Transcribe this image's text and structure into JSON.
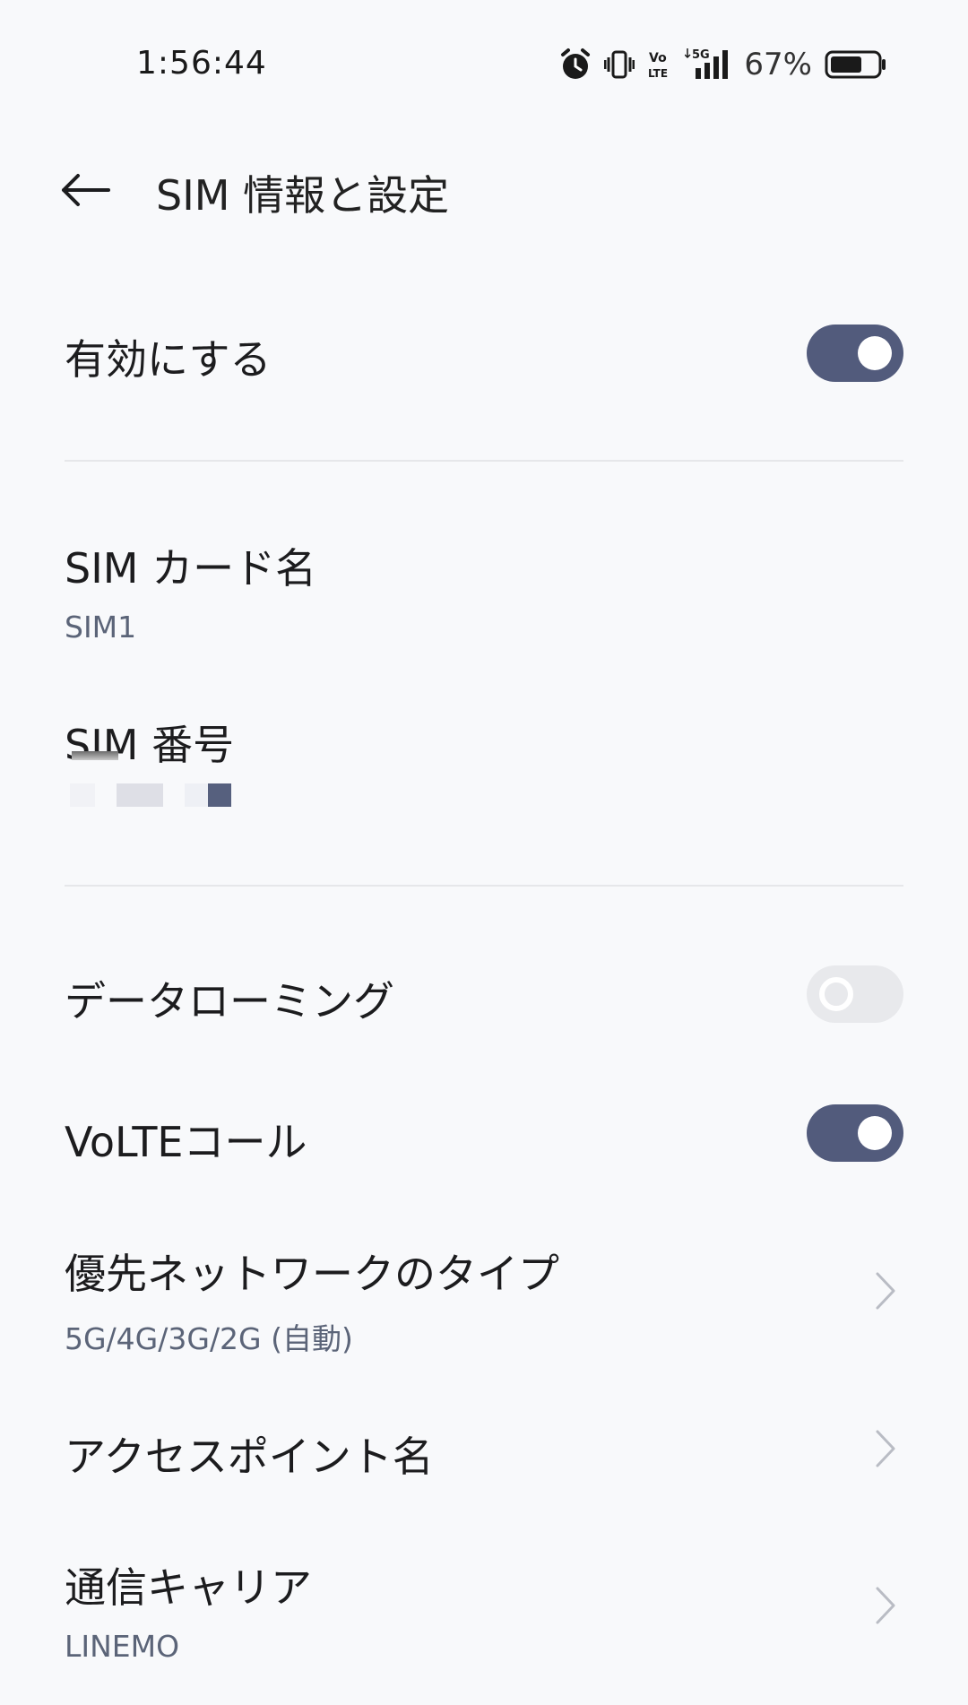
{
  "status_bar": {
    "time": "1:56:44",
    "battery_percent": "67%",
    "battery_level": 0.67,
    "network_label": "5G",
    "volte_label": "Vo LTE",
    "icons": [
      "alarm-icon",
      "vibrate-icon",
      "volte-icon",
      "signal-5g-icon",
      "battery-icon"
    ]
  },
  "header": {
    "title": "SIM 情報と設定",
    "back_icon": "arrow-left-icon"
  },
  "settings": {
    "enable": {
      "label": "有効にする",
      "enabled": true
    },
    "sim_card_name": {
      "label": "SIM カード名",
      "value": "SIM1"
    },
    "sim_number": {
      "label": "SIM 番号"
    },
    "data_roaming": {
      "label": "データローミング",
      "enabled": false
    },
    "volte_call": {
      "label": "VoLTEコール",
      "enabled": true
    },
    "preferred_network": {
      "label": "優先ネットワークのタイプ",
      "value": "5G/4G/3G/2G (自動)"
    },
    "apn": {
      "label": "アクセスポイント名"
    },
    "carrier": {
      "label": "通信キャリア",
      "value": "LINEMO"
    }
  },
  "colors": {
    "background": "#f8f9fb",
    "accent": "#525b7c",
    "subtext": "#5b6478",
    "divider": "#e6e7ea"
  }
}
